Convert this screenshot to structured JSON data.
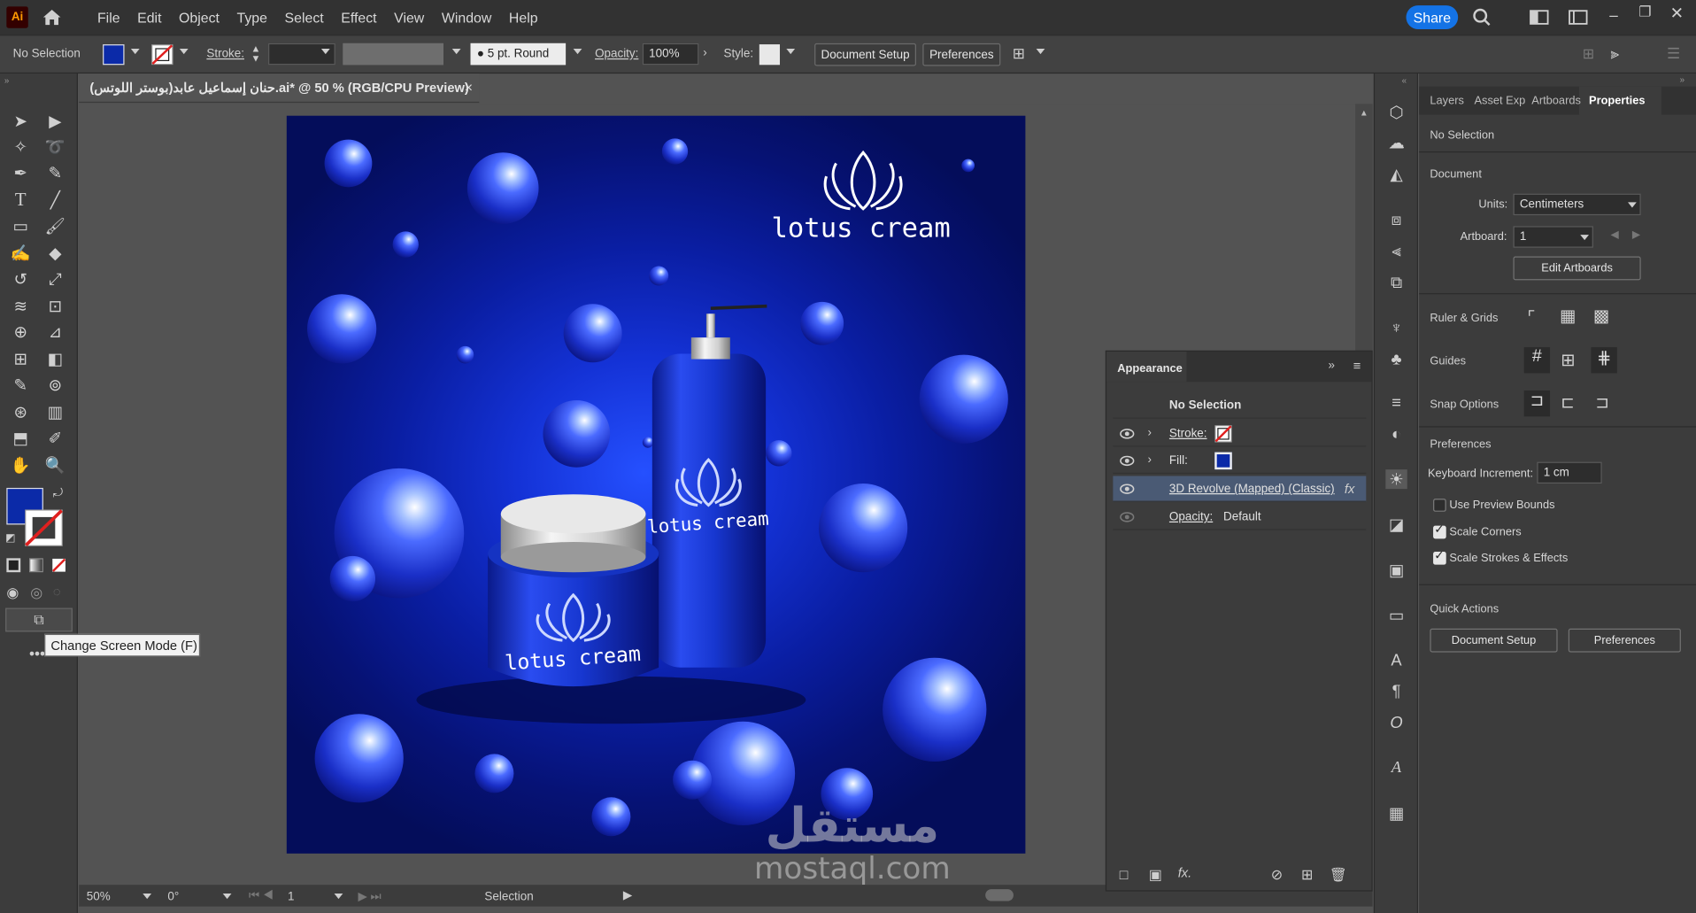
{
  "app": {
    "logo": "Ai"
  },
  "menu": [
    "File",
    "Edit",
    "Object",
    "Type",
    "Select",
    "Effect",
    "View",
    "Window",
    "Help"
  ],
  "topbar": {
    "share_label": "Share"
  },
  "control_bar": {
    "selection_label": "No Selection",
    "stroke_label": "Stroke:",
    "brush_value": "5 pt. Round",
    "opacity_label": "Opacity:",
    "opacity_value": "100%",
    "style_label": "Style:",
    "document_setup": "Document Setup",
    "preferences": "Preferences"
  },
  "document": {
    "tab_title": "(حنان إسماعيل عابد(بوستر اللوتس.ai* @ 50 % (RGB/CPU Preview)",
    "close": "×"
  },
  "artwork": {
    "brand_text": "lotus cream",
    "bottle_text": "lotus cream",
    "jar_text": "lotus cream",
    "colors": {
      "bg_deep": "#040d5a",
      "bg_bright": "#2550ff",
      "sphere": "#3b5cff"
    }
  },
  "status_bar": {
    "zoom": "50%",
    "rotation": "0°",
    "artboard": "1",
    "tool": "Selection"
  },
  "tooltip": {
    "text": "Change Screen Mode (F)"
  },
  "properties_panel": {
    "tabs": [
      "Layers",
      "Asset Exp",
      "Artboards",
      "Properties"
    ],
    "active_tab": "Properties",
    "selection": "No Selection",
    "document_title": "Document",
    "units_label": "Units:",
    "units_value": "Centimeters",
    "artboard_label": "Artboard:",
    "artboard_value": "1",
    "edit_artboards": "Edit Artboards",
    "ruler_grids": "Ruler & Grids",
    "guides": "Guides",
    "snap_options": "Snap Options",
    "preferences_title": "Preferences",
    "keyboard_increment_label": "Keyboard Increment:",
    "keyboard_increment_value": "1 cm",
    "use_preview_bounds": "Use Preview Bounds",
    "scale_corners": "Scale Corners",
    "scale_strokes": "Scale Strokes & Effects",
    "quick_actions": "Quick Actions",
    "document_setup_btn": "Document Setup",
    "preferences_btn": "Preferences"
  },
  "appearance_panel": {
    "title": "Appearance",
    "header": "No Selection",
    "rows": [
      {
        "label": "Stroke:"
      },
      {
        "label": "Fill:"
      },
      {
        "label": "3D Revolve (Mapped) (Classic)"
      },
      {
        "label": "Opacity:",
        "value": "Default"
      }
    ],
    "fx": "fx"
  },
  "watermark": {
    "arabic": "مستقل",
    "latin": "mostaql.com"
  }
}
